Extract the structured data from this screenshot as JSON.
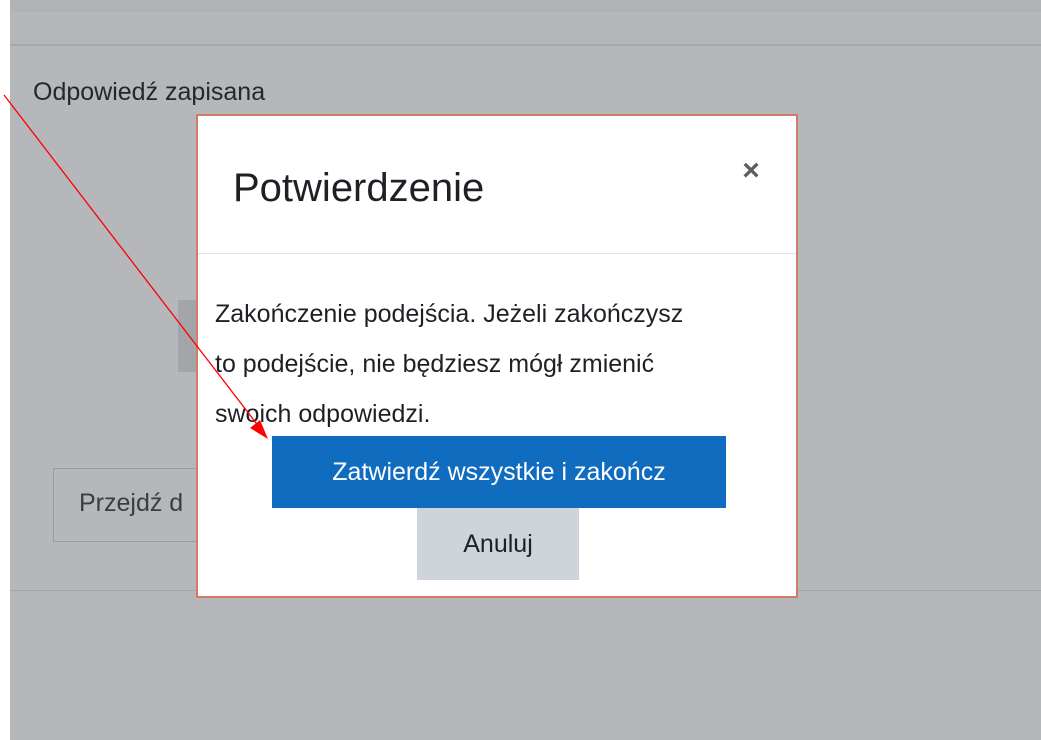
{
  "page": {
    "status_text": "Odpowiedź zapisana",
    "nav_button_label": "Przejdź d"
  },
  "modal": {
    "title": "Potwierdzenie",
    "close_symbol": "×",
    "body_lines": [
      "Zakończenie podejścia. Jeżeli zakończysz",
      "to podejście, nie będziesz mógł zmienić",
      "swoich odpowiedzi."
    ],
    "confirm_label": "Zatwierdź wszystkie i zakończ",
    "cancel_label": "Anuluj"
  },
  "colors": {
    "primary": "#0f6cbf",
    "secondary": "#ced4da",
    "backdrop": "#b5b7ba",
    "modal_border": "#d07c66",
    "annotation_arrow": "#ff0000"
  },
  "icons": {
    "close": "close-icon",
    "annotation": "arrow-annotation"
  }
}
